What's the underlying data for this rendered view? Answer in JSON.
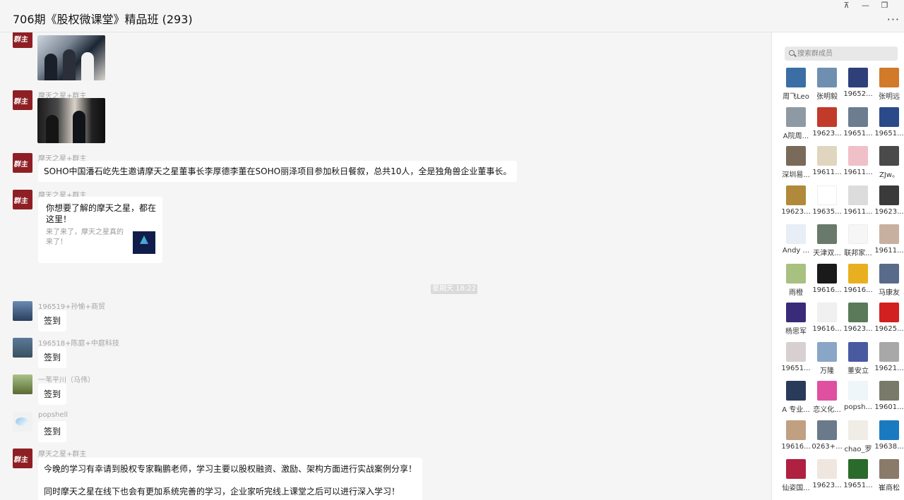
{
  "header": {
    "title": "706期《股权微课堂》精品班 (293)",
    "pin_icon": "pin-icon",
    "minimize_icon": "minimize-icon",
    "restore_icon": "restore-icon",
    "more_icon": "more-icon"
  },
  "chat": {
    "messages": [
      {
        "sender": "",
        "type": "image"
      },
      {
        "sender": "摩天之星+群主",
        "type": "image"
      },
      {
        "sender": "摩天之星+群主",
        "text": "SOHO中国潘石屹先生邀请摩天之星董事长李厚德李董在SOHO丽泽项目参加秋日餐叙，总共10人，全是独角兽企业董事长。"
      },
      {
        "sender": "摩天之星+群主",
        "type": "card",
        "card_title": "你想要了解的摩天之星，都在这里！",
        "card_desc": "来了来了，摩天之星真的来了！"
      },
      {
        "sender": "196519+孙愉+商贸",
        "text": "签到"
      },
      {
        "sender": "196518+陈庭+中庭科技",
        "text": "签到"
      },
      {
        "sender": "一苇平川（马伟）",
        "text": "签到"
      },
      {
        "sender": "popshell",
        "text": "签到"
      },
      {
        "sender": "摩天之星+群主",
        "lines": [
          "今晚的学习有幸请到股权专家鞠鹏老师，学习主要以股权融资、激励、架构方面进行实战案例分享！",
          "同时摩天之星在线下也会有更加系统完善的学习，企业家听完线上课堂之后可以进行深入学习！"
        ]
      }
    ],
    "time_divider": "星期天 18:22"
  },
  "members": {
    "search_placeholder": "搜索群成员",
    "list": [
      {
        "name": "周飞Leo",
        "color": "#3a6ea5"
      },
      {
        "name": "张明毅",
        "color": "#6f8fb0"
      },
      {
        "name": "19652...",
        "color": "#2f3f7a"
      },
      {
        "name": "张明远",
        "color": "#d07a2a"
      },
      {
        "name": "A院周...",
        "color": "#8e9aa3"
      },
      {
        "name": "19623...",
        "color": "#c23a2a"
      },
      {
        "name": "19651...",
        "color": "#6b7d8e"
      },
      {
        "name": "19651...",
        "color": "#2a4a8a"
      },
      {
        "name": "深圳易...",
        "color": "#7a6a5a"
      },
      {
        "name": "19611...",
        "color": "#e0d6c0"
      },
      {
        "name": "19611...",
        "color": "#f0c0c8"
      },
      {
        "name": "ZJw。",
        "color": "#4a4a4a"
      },
      {
        "name": "19623...",
        "color": "#b08a3a"
      },
      {
        "name": "19635...",
        "color": "#ffffff"
      },
      {
        "name": "19611...",
        "color": "#dcdcdc"
      },
      {
        "name": "19623...",
        "color": "#3a3a3a"
      },
      {
        "name": "Andy ...",
        "color": "#e8eef6"
      },
      {
        "name": "天津双...",
        "color": "#6a7a6a"
      },
      {
        "name": "联邦家...",
        "color": "#f6f6f6"
      },
      {
        "name": "19611...",
        "color": "#c8b0a0"
      },
      {
        "name": "雨橙",
        "color": "#a8c080"
      },
      {
        "name": "19616...",
        "color": "#1a1a1a"
      },
      {
        "name": "19616...",
        "color": "#e8b020"
      },
      {
        "name": "马康友",
        "color": "#5a6a8a"
      },
      {
        "name": "杨思军",
        "color": "#3a2a7a"
      },
      {
        "name": "19616...",
        "color": "#f0f0f0"
      },
      {
        "name": "19623...",
        "color": "#5a7a5a"
      },
      {
        "name": "19625...",
        "color": "#d02020"
      },
      {
        "name": "19651...",
        "color": "#d8d0d0"
      },
      {
        "name": "万隆",
        "color": "#8aa6c6"
      },
      {
        "name": "董安立",
        "color": "#4a5aa0"
      },
      {
        "name": "19621...",
        "color": "#a8a8a8"
      },
      {
        "name": "A 专业...",
        "color": "#2a3a5a"
      },
      {
        "name": "恋义化...",
        "color": "#e050a0"
      },
      {
        "name": "popsh...",
        "color": "#eef6fa"
      },
      {
        "name": "19601...",
        "color": "#7a7a6a"
      },
      {
        "name": "19616...",
        "color": "#c0a080"
      },
      {
        "name": "0263+...",
        "color": "#6a7a8a"
      },
      {
        "name": "chao_罗",
        "color": "#f0ece6"
      },
      {
        "name": "19638...",
        "color": "#1a7ac0"
      },
      {
        "name": "仙姿国...",
        "color": "#b02040"
      },
      {
        "name": "19623...",
        "color": "#f0e6e0"
      },
      {
        "name": "19651...",
        "color": "#2a6a2a"
      },
      {
        "name": "崔商松",
        "color": "#8a7a6a"
      }
    ]
  }
}
